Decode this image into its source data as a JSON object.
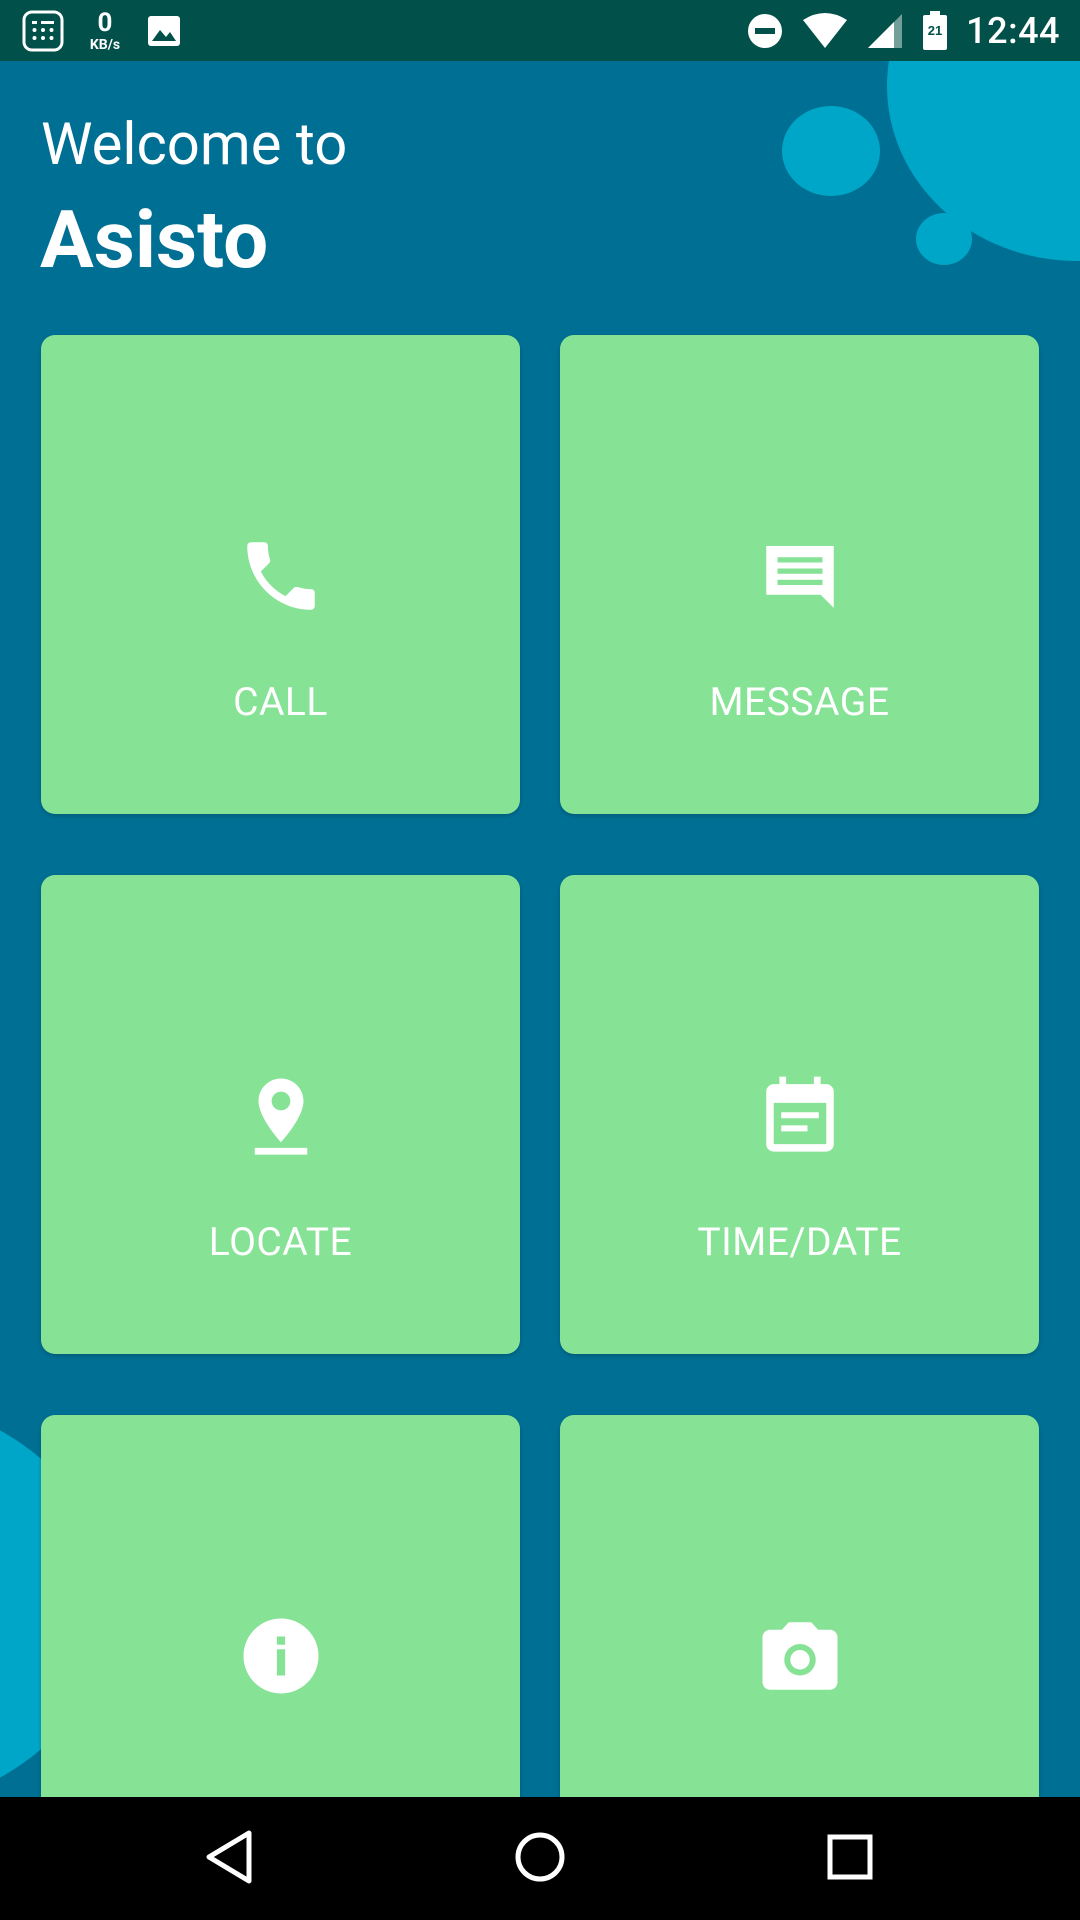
{
  "status_bar": {
    "net_speed_value": "0",
    "net_speed_unit": "KB/s",
    "battery_level": "21",
    "time": "12:44",
    "icons": [
      "calculator-icon",
      "image-icon",
      "do-not-disturb-icon",
      "wifi-icon",
      "cell-signal-icon",
      "battery-icon"
    ]
  },
  "header": {
    "welcome": "Welcome to",
    "app_name": "Asisto"
  },
  "tiles": [
    {
      "label": "CALL",
      "icon": "phone-icon"
    },
    {
      "label": "MESSAGE",
      "icon": "message-icon"
    },
    {
      "label": "LOCATE",
      "icon": "location-pin-icon"
    },
    {
      "label": "TIME/DATE",
      "icon": "calendar-icon"
    },
    {
      "label": "",
      "icon": "info-icon"
    },
    {
      "label": "",
      "icon": "camera-icon"
    }
  ],
  "nav_bar": {
    "icons": [
      "back-icon",
      "home-icon",
      "recents-icon"
    ]
  },
  "colors": {
    "status_bar_bg": "#01504a",
    "background": "#006f94",
    "bubble": "#00a6c7",
    "tile": "#86e295",
    "text": "#ffffff",
    "nav_bar_bg": "#000000"
  }
}
